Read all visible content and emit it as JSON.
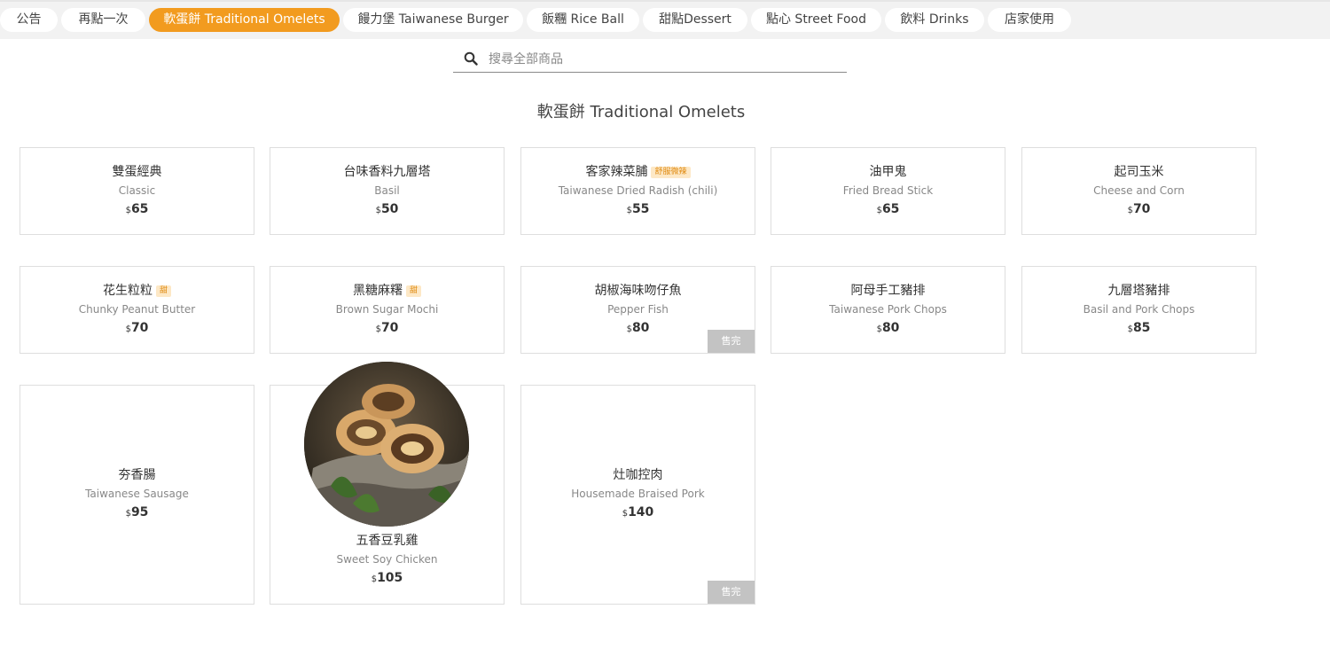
{
  "tabs": [
    {
      "label": "公告",
      "active": false
    },
    {
      "label": "再點一次",
      "active": false
    },
    {
      "label": "軟蛋餅 Traditional Omelets",
      "active": true
    },
    {
      "label": "饅力堡 Taiwanese Burger",
      "active": false
    },
    {
      "label": "飯糰 Rice Ball",
      "active": false
    },
    {
      "label": "甜點Dessert",
      "active": false
    },
    {
      "label": "點心 Street Food",
      "active": false
    },
    {
      "label": "飲料 Drinks",
      "active": false
    },
    {
      "label": "店家使用",
      "active": false
    }
  ],
  "search": {
    "placeholder": "搜尋全部商品",
    "icon": "search-icon"
  },
  "section_title": "軟蛋餅 Traditional Omelets",
  "currency": "$",
  "sold_out_label": "售完",
  "items": [
    {
      "name": "雙蛋經典",
      "en": "Classic",
      "price": "65"
    },
    {
      "name": "台味香料九層塔",
      "en": "Basil",
      "price": "50"
    },
    {
      "name": "客家辣菜脯",
      "badge": "舒服微辣",
      "en": "Taiwanese Dried Radish (chili)",
      "price": "55"
    },
    {
      "name": "油甲鬼",
      "en": "Fried Bread Stick",
      "price": "65"
    },
    {
      "name": "起司玉米",
      "en": "Cheese and Corn",
      "price": "70"
    },
    {
      "name": "花生粒粒",
      "badge": "甜",
      "en": "Chunky Peanut Butter",
      "price": "70"
    },
    {
      "name": "黑糖麻糬",
      "badge": "甜",
      "en": "Brown Sugar Mochi",
      "price": "70"
    },
    {
      "name": "胡椒海味吻仔魚",
      "en": "Pepper Fish",
      "price": "80",
      "sold_out": true
    },
    {
      "name": "阿母手工豬排",
      "en": "Taiwanese Pork Chops",
      "price": "80"
    },
    {
      "name": "九層塔豬排",
      "en": "Basil and Pork Chops",
      "price": "85"
    },
    {
      "name": "夯香腸",
      "en": "Taiwanese Sausage",
      "price": "95"
    },
    {
      "name": "五香豆乳雞",
      "en": "Sweet Soy Chicken",
      "price": "105",
      "photo": "omelet-roll-photo"
    },
    {
      "name": "灶咖控肉",
      "en": "Housemade Braised Pork",
      "price": "140",
      "sold_out": true
    }
  ]
}
